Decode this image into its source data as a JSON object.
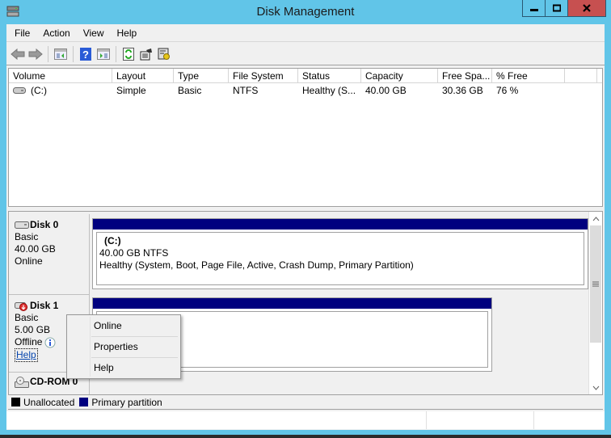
{
  "window": {
    "title": "Disk Management",
    "controls": [
      "minimize",
      "maximize",
      "close"
    ]
  },
  "menubar": {
    "items": [
      {
        "label": "File"
      },
      {
        "label": "Action"
      },
      {
        "label": "View"
      },
      {
        "label": "Help"
      }
    ]
  },
  "toolbar": {
    "buttons": [
      "back-icon",
      "forward-icon",
      "show-hide-console-tree-icon",
      "help-icon",
      "show-hide-action-pane-icon",
      "refresh-icon",
      "properties-icon",
      "settings-icon"
    ]
  },
  "volume_list": {
    "columns": [
      "Volume",
      "Layout",
      "Type",
      "File System",
      "Status",
      "Capacity",
      "Free Spa...",
      "% Free"
    ],
    "rows": [
      {
        "volume": "(C:)",
        "layout": "Simple",
        "type": "Basic",
        "file_system": "NTFS",
        "status": "Healthy (S...",
        "capacity": "40.00 GB",
        "free_space": "30.36 GB",
        "percent_free": "76 %"
      }
    ]
  },
  "disks": [
    {
      "name": "Disk 0",
      "type": "Basic",
      "size": "40.00 GB",
      "state": "Online",
      "partition": {
        "label": "(C:)",
        "size_fs": "40.00 GB NTFS",
        "status": "Healthy (System, Boot, Page File, Active, Crash Dump, Primary Partition)"
      }
    },
    {
      "name": "Disk 1",
      "type": "Basic",
      "size": "5.00 GB",
      "state": "Offline",
      "help_link": "Help"
    },
    {
      "name": "CD-ROM 0"
    }
  ],
  "context_menu": {
    "items": [
      {
        "label": "Online"
      },
      {
        "label": "Properties"
      },
      {
        "label": "Help"
      }
    ]
  },
  "legend": {
    "items": [
      {
        "label": "Unallocated",
        "color": "#000000"
      },
      {
        "label": "Primary partition",
        "color": "#00007f"
      }
    ]
  },
  "colors": {
    "titlebar": "#61c5e8",
    "close_button": "#c75050",
    "partition_bar": "#00007f"
  }
}
